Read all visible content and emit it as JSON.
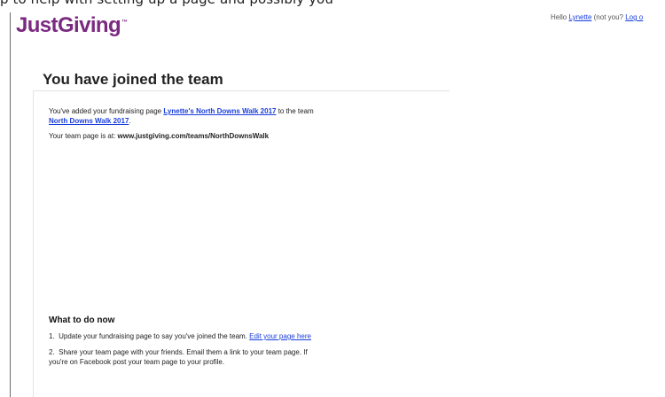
{
  "top_strip_text": "p to help with setting up a page and possibly you",
  "brand": {
    "logo_text": "JustGiving",
    "logo_tm": "™",
    "color": "#7b2a81"
  },
  "account": {
    "greeting": "Hello ",
    "user_name": "Lynette",
    "not_you": " (not you? ",
    "logout_label": "Log o"
  },
  "page": {
    "title": "You have joined the team",
    "intro_prefix": "You've added your fundraising page ",
    "page_name": "Lynette's North Downs Walk 2017",
    "intro_mid": " to the team",
    "team_name": "North Downs Walk 2017",
    "intro_suffix": ".",
    "team_url_prefix": "Your team page is at: ",
    "team_url": "www.justgiving.com/teams/NorthDownsWalk"
  },
  "what_to_do": {
    "heading": "What to do now",
    "steps": [
      {
        "number": "1.",
        "text": "Update your fundraising page to say you've joined the team. ",
        "link": "Edit your page here"
      },
      {
        "number": "2.",
        "line1": "Share your team page with your friends. Email them a link to your team page. If",
        "line2": "you're on Facebook post your team page to your profile."
      }
    ]
  },
  "colors": {
    "link": "#1a3edb",
    "brand": "#7b2a81",
    "divider": "#e3e3e3"
  }
}
